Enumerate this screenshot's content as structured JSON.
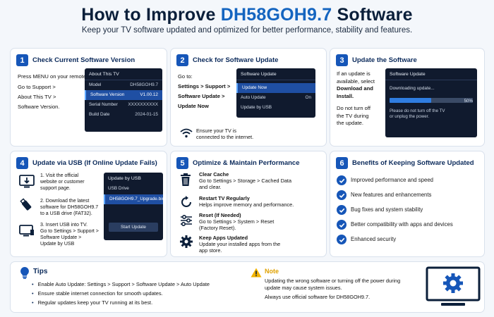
{
  "header": {
    "title_prefix": "How to Improve ",
    "title_accent": "DH58GOH9.7",
    "title_suffix": " Software",
    "subtitle": "Keep your TV software updated and optimized for better performance, stability and features."
  },
  "colors": {
    "accent": "#1565c0",
    "navy": "#0b1f3a",
    "badge": "#1656b8",
    "screen": "#101a2e"
  },
  "step1": {
    "num": "1",
    "title": "Check Current Software Version",
    "text1": "Press MENU on your remote.",
    "text2": "Go to Support >",
    "text3": "About This TV >",
    "text4": "Software Version.",
    "screen": {
      "title": "About This TV",
      "rows": [
        {
          "label": "Model",
          "value": "DH58GOH9.7"
        },
        {
          "label": "Software Version",
          "value": "V1.00.12"
        },
        {
          "label": "Serial Number",
          "value": "XXXXXXXXXX"
        },
        {
          "label": "Build Date",
          "value": "2024-01-15"
        }
      ]
    }
  },
  "step2": {
    "num": "2",
    "title": "Check for Software Update",
    "text1": "Go to:",
    "text2": "Settings > Support >",
    "text3": "Software Update >",
    "text4": "Update Now",
    "screen": {
      "title": "Software Update",
      "rows": [
        {
          "label": "Update Now",
          "value": ""
        },
        {
          "label": "Auto Update",
          "value": "On"
        },
        {
          "label": "Update by USB",
          "value": ""
        }
      ]
    },
    "wifi_line1": "Ensure your TV is",
    "wifi_line2": "connected to the internet.",
    "wifi_icon": "wifi-icon"
  },
  "step3": {
    "num": "3",
    "title": "Update the Software",
    "text1": "If an update is",
    "text2": "available, select",
    "text3": "Download and",
    "text4": "Install.",
    "text5": "Do not turn off",
    "text6": "the TV during",
    "text7": "the update.",
    "screen": {
      "title": "Software Update",
      "status": "Downloading update...",
      "percent_label": "50%",
      "progress": 0.5,
      "note1": "Please do not turn off the TV",
      "note2": "or unplug the power."
    }
  },
  "step4": {
    "num": "4",
    "title": "Update via USB (If Online Update Fails)",
    "item1": [
      "1. Visit the official",
      "website or customer",
      "support page."
    ],
    "item2": [
      "2. Download the latest",
      "software for DH58GOH9.7",
      "to a USB drive (FAT32)."
    ],
    "item3": [
      "3. Insert USB into TV.",
      "Go to Settings > Support >",
      "Software Update >",
      "Update by USB"
    ],
    "screen": {
      "title": "Update by USB",
      "row1": "USB Drive",
      "row2_label": "DH58GOH9.7_Upgrade.bin",
      "button": "Start Update"
    }
  },
  "step5": {
    "num": "5",
    "title": "Optimize & Maintain Performance",
    "items": [
      {
        "title": "Clear Cache",
        "line1": "Go to Settings > Storage > Cached Data",
        "line2": "and clear.",
        "icon": "trash-icon"
      },
      {
        "title": "Restart TV Regularly",
        "line1": "Helps improve memory and performance.",
        "line2": "",
        "icon": "restart-icon"
      },
      {
        "title": "Reset (If Needed)",
        "line1": "Go to Settings > System > Reset",
        "line2": "(Factory Reset).",
        "icon": "sliders-icon"
      },
      {
        "title": "Keep Apps Updated",
        "line1": "Update your installed apps from the",
        "line2": "app store.",
        "icon": "gear-icon"
      }
    ]
  },
  "step6": {
    "num": "6",
    "title": "Benefits of Keeping Software Updated",
    "benefits": [
      "Improved performance and speed",
      "New features and enhancements",
      "Bug fixes and system stability",
      "Better compatibility with apps and devices",
      "Enhanced security"
    ]
  },
  "tips": {
    "title": "Tips",
    "items": [
      "Enable Auto Update: Settings > Support > Software Update > Auto Update",
      "Ensure stable internet connection for smooth updates.",
      "Regular updates keep your TV running at its best."
    ]
  },
  "note": {
    "title": "Note",
    "line1": "Updating the wrong software or turning off the power during",
    "line2": "update may cause system issues.",
    "line3": "Always use official software for DH58GOH9.7."
  }
}
